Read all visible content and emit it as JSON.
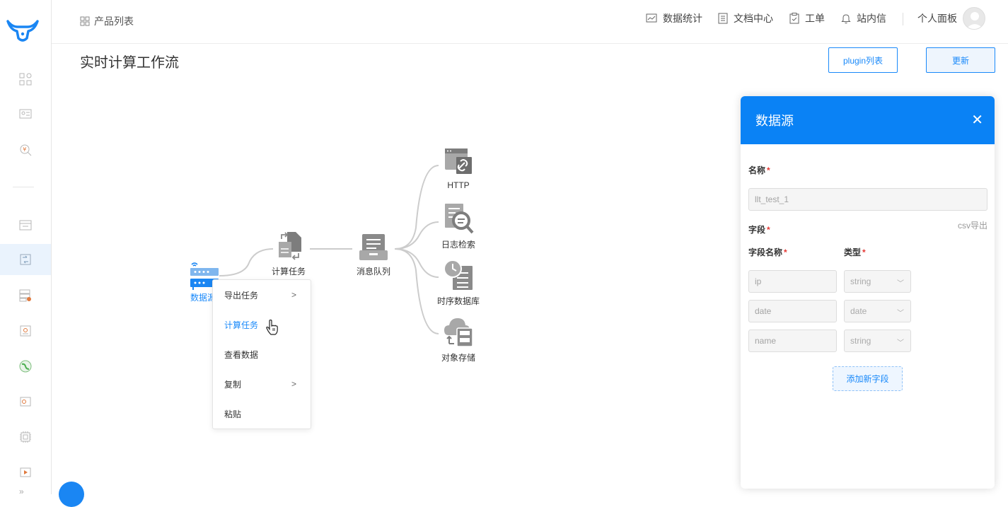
{
  "topbar": {
    "product_list": "产品列表",
    "nav": [
      {
        "label": "数据统计",
        "icon": "chart-icon"
      },
      {
        "label": "文档中心",
        "icon": "document-icon"
      },
      {
        "label": "工单",
        "icon": "clipboard-icon"
      },
      {
        "label": "站内信",
        "icon": "bell-icon"
      }
    ],
    "personal_panel": "个人面板"
  },
  "page": {
    "title": "实时计算工作流",
    "plugin_list_button": "plugin列表",
    "update_button": "更新"
  },
  "flow": {
    "nodes": {
      "datasource": "数据源",
      "compute": "计算任务",
      "mq": "消息队列",
      "http": "HTTP",
      "log": "日志检索",
      "tsdb": "时序数据库",
      "oss": "对象存储"
    }
  },
  "context_menu": {
    "items": [
      "导出任务",
      "计算任务",
      "查看数据",
      "复制",
      "粘贴"
    ],
    "active_index": 1
  },
  "panel": {
    "title": "数据源",
    "name_label": "名称",
    "name_value": "llt_test_1",
    "fields_label": "字段",
    "csv_export": "csv导出",
    "field_name_header": "字段名称",
    "type_header": "类型",
    "fields": [
      {
        "name": "ip",
        "type": "string"
      },
      {
        "name": "date",
        "type": "date"
      },
      {
        "name": "name",
        "type": "string"
      }
    ],
    "add_field_button": "添加新字段"
  },
  "colors": {
    "accent": "#1989fa",
    "panel_header": "#0a82f5",
    "required": "#e53935",
    "node_gray": "#8a8a8a"
  }
}
